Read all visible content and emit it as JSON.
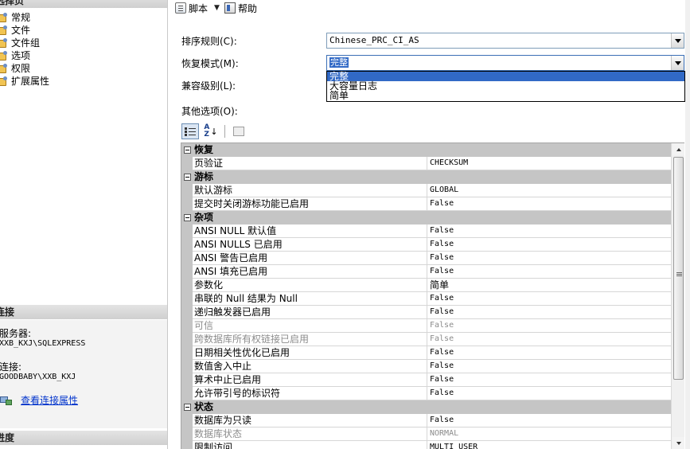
{
  "left_panel": {
    "select_page_header": "选择页",
    "pages": [
      "常规",
      "文件",
      "文件组",
      "选项",
      "权限",
      "扩展属性"
    ],
    "connection_header": "连接",
    "server_label": "服务器:",
    "server_value": "XXB_KXJ\\SQLEXPRESS",
    "connection_label": "连接:",
    "connection_value": "GOODBABY\\XXB_KXJ",
    "view_conn_props": "查看连接属性",
    "progress_header": "进度"
  },
  "toolbar": {
    "script_label": "脚本",
    "help_label": "帮助"
  },
  "form": {
    "collation_label": "排序规则(C):",
    "collation_value": "Chinese_PRC_CI_AS",
    "recovery_label": "恢复模式(M):",
    "recovery_value": "完整",
    "recovery_options": [
      "完整",
      "大容量日志",
      "简单"
    ],
    "compat_label": "兼容级别(L):",
    "other_options_label": "其他选项(O):"
  },
  "grid": {
    "rows": [
      {
        "type": "cat",
        "label": "恢复"
      },
      {
        "type": "prop",
        "name": "页验证",
        "value": "CHECKSUM"
      },
      {
        "type": "cat",
        "label": "游标"
      },
      {
        "type": "prop",
        "name": "默认游标",
        "value": "GLOBAL"
      },
      {
        "type": "prop",
        "name": "提交时关闭游标功能已启用",
        "value": "False"
      },
      {
        "type": "cat",
        "label": "杂项"
      },
      {
        "type": "prop",
        "name": "ANSI NULL 默认值",
        "value": "False"
      },
      {
        "type": "prop",
        "name": "ANSI NULLS 已启用",
        "value": "False"
      },
      {
        "type": "prop",
        "name": "ANSI 警告已启用",
        "value": "False"
      },
      {
        "type": "prop",
        "name": "ANSI 填充已启用",
        "value": "False"
      },
      {
        "type": "prop",
        "name": "参数化",
        "value": "简单"
      },
      {
        "type": "prop",
        "name": "串联的 Null 结果为 Null",
        "value": "False"
      },
      {
        "type": "prop",
        "name": "递归触发器已启用",
        "value": "False"
      },
      {
        "type": "prop",
        "name": "可信",
        "value": "False",
        "disabled": true
      },
      {
        "type": "prop",
        "name": "跨数据库所有权链接已启用",
        "value": "False",
        "disabled": true
      },
      {
        "type": "prop",
        "name": "日期相关性优化已启用",
        "value": "False"
      },
      {
        "type": "prop",
        "name": "数值舍入中止",
        "value": "False"
      },
      {
        "type": "prop",
        "name": "算术中止已启用",
        "value": "False"
      },
      {
        "type": "prop",
        "name": "允许带引号的标识符",
        "value": "False"
      },
      {
        "type": "cat",
        "label": "状态"
      },
      {
        "type": "prop",
        "name": "数据库为只读",
        "value": "False"
      },
      {
        "type": "prop",
        "name": "数据库状态",
        "value": "NORMAL",
        "disabled": true
      },
      {
        "type": "prop",
        "name": "限制访问",
        "value": "MULTI_USER"
      }
    ]
  }
}
